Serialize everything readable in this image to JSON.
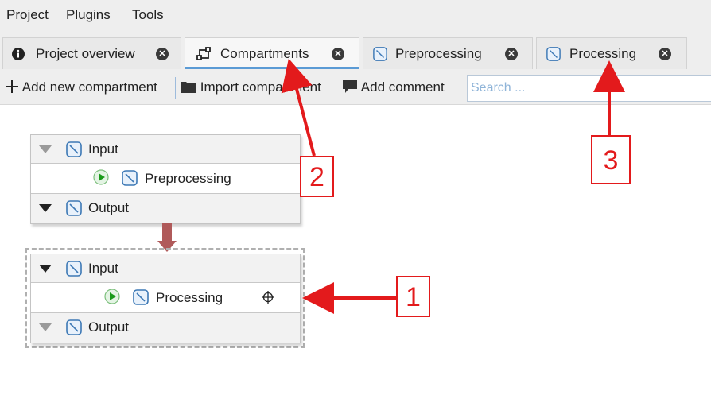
{
  "menubar": {
    "items": [
      "Project",
      "Plugins",
      "Tools"
    ]
  },
  "tabs": [
    {
      "label": "Project overview",
      "icon": "info-icon",
      "active": false
    },
    {
      "label": "Compartments",
      "icon": "compartments-icon",
      "active": true
    },
    {
      "label": "Preprocessing",
      "icon": "graph-icon",
      "active": false
    },
    {
      "label": "Processing",
      "icon": "graph-icon",
      "active": false
    }
  ],
  "toolbar": {
    "add_new": "Add new compartment",
    "import": "Import compartment",
    "add_comment": "Add comment",
    "search_placeholder": "Search ..."
  },
  "nodes": [
    {
      "input": "Input",
      "name": "Preprocessing",
      "output": "Output"
    },
    {
      "input": "Input",
      "name": "Processing",
      "output": "Output"
    }
  ],
  "annotations": [
    "1",
    "2",
    "3"
  ],
  "colors": {
    "annotation": "#e31a1c",
    "connector": "#b05a5a",
    "active_tab_underline": "#5b9bd5"
  }
}
